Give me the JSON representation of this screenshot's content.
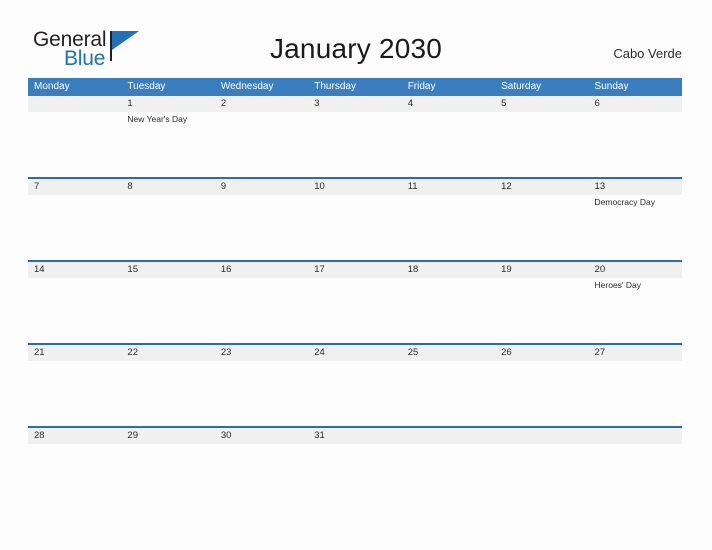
{
  "logo": {
    "line1": "General",
    "line2": "Blue",
    "accent_color": "#1f72b8"
  },
  "header": {
    "title": "January 2030",
    "country": "Cabo Verde"
  },
  "calendar": {
    "header_color": "#3a7ebf",
    "date_band_color": "#f0f0f0",
    "rule_color": "#2a6ca8",
    "weekdays": [
      "Monday",
      "Tuesday",
      "Wednesday",
      "Thursday",
      "Friday",
      "Saturday",
      "Sunday"
    ],
    "weeks": [
      [
        {
          "date": "",
          "event": ""
        },
        {
          "date": "1",
          "event": "New Year's Day"
        },
        {
          "date": "2",
          "event": ""
        },
        {
          "date": "3",
          "event": ""
        },
        {
          "date": "4",
          "event": ""
        },
        {
          "date": "5",
          "event": ""
        },
        {
          "date": "6",
          "event": ""
        }
      ],
      [
        {
          "date": "7",
          "event": ""
        },
        {
          "date": "8",
          "event": ""
        },
        {
          "date": "9",
          "event": ""
        },
        {
          "date": "10",
          "event": ""
        },
        {
          "date": "11",
          "event": ""
        },
        {
          "date": "12",
          "event": ""
        },
        {
          "date": "13",
          "event": "Democracy Day"
        }
      ],
      [
        {
          "date": "14",
          "event": ""
        },
        {
          "date": "15",
          "event": ""
        },
        {
          "date": "16",
          "event": ""
        },
        {
          "date": "17",
          "event": ""
        },
        {
          "date": "18",
          "event": ""
        },
        {
          "date": "19",
          "event": ""
        },
        {
          "date": "20",
          "event": "Heroes' Day"
        }
      ],
      [
        {
          "date": "21",
          "event": ""
        },
        {
          "date": "22",
          "event": ""
        },
        {
          "date": "23",
          "event": ""
        },
        {
          "date": "24",
          "event": ""
        },
        {
          "date": "25",
          "event": ""
        },
        {
          "date": "26",
          "event": ""
        },
        {
          "date": "27",
          "event": ""
        }
      ],
      [
        {
          "date": "28",
          "event": ""
        },
        {
          "date": "29",
          "event": ""
        },
        {
          "date": "30",
          "event": ""
        },
        {
          "date": "31",
          "event": ""
        },
        {
          "date": "",
          "event": ""
        },
        {
          "date": "",
          "event": ""
        },
        {
          "date": "",
          "event": ""
        }
      ]
    ]
  }
}
